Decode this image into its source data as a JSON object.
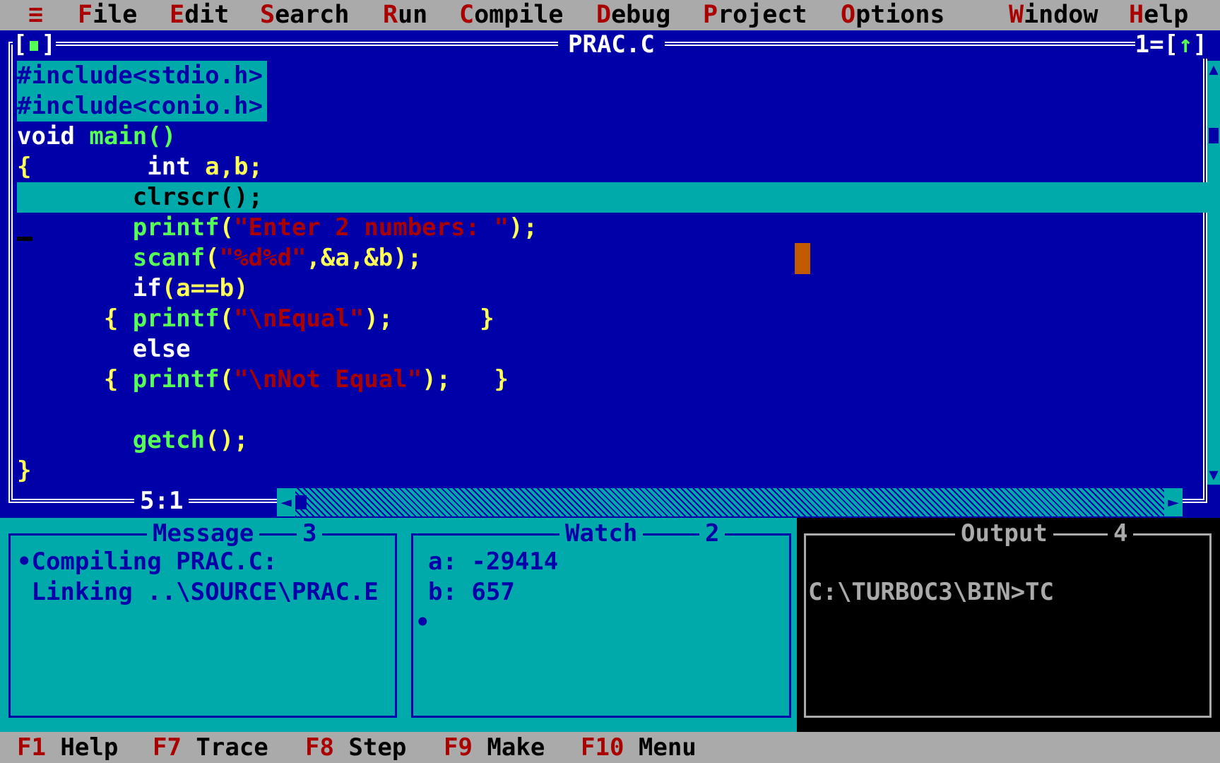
{
  "menubar": {
    "system_icon": "≡",
    "items": [
      {
        "hot": "F",
        "rest": "ile"
      },
      {
        "hot": "E",
        "rest": "dit"
      },
      {
        "hot": "S",
        "rest": "earch"
      },
      {
        "hot": "R",
        "rest": "un"
      },
      {
        "hot": "C",
        "rest": "ompile"
      },
      {
        "hot": "D",
        "rest": "ebug"
      },
      {
        "hot": "P",
        "rest": "roject"
      },
      {
        "hot": "O",
        "rest": "ptions"
      },
      {
        "hot": "W",
        "rest": "indow"
      },
      {
        "hot": "H",
        "rest": "elp"
      }
    ]
  },
  "editor": {
    "title": "PRAC.C",
    "window_number": "1",
    "close_left": "[",
    "close_right": "]",
    "zoom_prefix": "1=[",
    "zoom_arrow": "↑",
    "zoom_suffix": "]",
    "cursor_position": "5:1",
    "lines": {
      "l1": "#include<stdio.h>",
      "l2": "#include<conio.h>",
      "l3_kw": "void",
      "l3_id": " main()",
      "l4_brace": "{",
      "l4_kw": "        int",
      "l4_rest": " a,b;",
      "l5": "        clrscr();",
      "l6_fn": "        printf",
      "l6_open": "(",
      "l6_str": "\"Enter 2 numbers: \"",
      "l6_close": ");",
      "l7_fn": "        scanf",
      "l7_open": "(",
      "l7_str": "\"%d%d\"",
      "l7_close": ",&a,&b);",
      "l8_kw": "        if",
      "l8_rest": "(a==b)",
      "l9_brace": "      {",
      "l9_fn": " printf",
      "l9_open": "(",
      "l9_str": "\"\\nEqual\"",
      "l9_close": ");",
      "l9_end": "      }",
      "l10": "        else",
      "l11_brace": "      {",
      "l11_fn": " printf",
      "l11_open": "(",
      "l11_str": "\"\\nNot Equal\"",
      "l11_close": ");",
      "l11_end": "   }",
      "l12": "",
      "l13_fn": "        getch",
      "l13_rest": "();",
      "l14": "}"
    }
  },
  "message": {
    "title": "Message",
    "number": "3",
    "lines": [
      "•Compiling PRAC.C:",
      " Linking ..\\SOURCE\\PRAC.E"
    ]
  },
  "watch": {
    "title": "Watch",
    "number": "2",
    "lines": [
      "a: -29414",
      "b: 657",
      "•"
    ]
  },
  "output": {
    "title": "Output",
    "number": "4",
    "lines": [
      "C:\\TURBOC3\\BIN>TC"
    ]
  },
  "fbar": [
    {
      "key": "F1",
      "label": " Help"
    },
    {
      "key": "F7",
      "label": " Trace"
    },
    {
      "key": "F8",
      "label": " Step"
    },
    {
      "key": "F9",
      "label": " Make"
    },
    {
      "key": "F10",
      "label": " Menu"
    }
  ],
  "colors": {
    "background": "#0000a8",
    "menubar": "#aaaaaa",
    "hotkey": "#aa0000",
    "panel": "#00aaaa",
    "keyword": "#ffffff",
    "identifier": "#55ff55",
    "symbol": "#ffff55",
    "string": "#aa0000"
  }
}
